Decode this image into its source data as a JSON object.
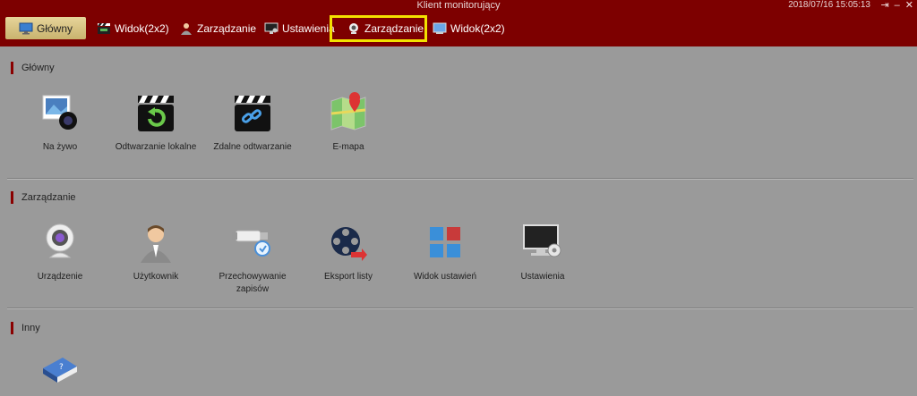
{
  "window": {
    "title": "Klient monitorujący",
    "datetime": "2018/07/16 15:05:13"
  },
  "tabs": [
    {
      "label": "Główny",
      "icon": "monitor-icon"
    },
    {
      "label": "Widok(2x2)",
      "icon": "clapper-icon"
    },
    {
      "label": "Zarządzanie",
      "icon": "user-icon"
    },
    {
      "label": "Ustawienia",
      "icon": "settings-monitor-icon"
    },
    {
      "label": "Zarządzanie",
      "icon": "webcam-icon"
    },
    {
      "label": "Widok(2x2)",
      "icon": "view-icon"
    }
  ],
  "sections": [
    {
      "title": "Główny",
      "items": [
        "Na żywo",
        "Odtwarzanie lokalne",
        "Zdalne odtwarzanie",
        "E-mapa"
      ]
    },
    {
      "title": "Zarządzanie",
      "items": [
        "Urządzenie",
        "Użytkownik",
        "Przechowywanie zapisów",
        "Eksport listy",
        "Widok ustawień",
        "Ustawienia"
      ]
    },
    {
      "title": "Inny",
      "items": [
        ""
      ]
    }
  ],
  "colors": {
    "titlebar": "#7d0000",
    "highlight": "#f3e200",
    "background": "#9a9a9a"
  }
}
